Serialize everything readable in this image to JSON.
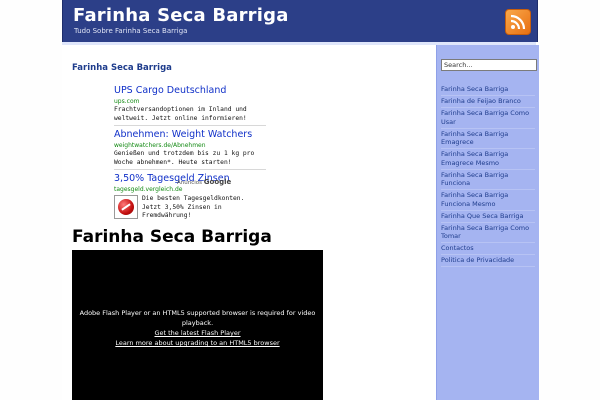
{
  "header": {
    "site_title": "Farinha Seca Barriga",
    "site_description": "Tudo Sobre Farinha Seca Barriga",
    "bg_color": "#2c3f88",
    "rss_icon": "rss-feed-icon"
  },
  "content": {
    "title": "Farinha Seca Barriga",
    "post_title": "Farinha Seca Barriga"
  },
  "ads": {
    "items": [
      {
        "title": "UPS Cargo Deutschland",
        "url": "ups.com",
        "text_line1": "Frachtversandoptionen im Inland und",
        "text_line2": "weltweit. Jetzt online informieren!"
      },
      {
        "title": "Abnehmen: Weight Watchers",
        "url": "weightwatchers.de/Abnehmen",
        "text_line1": "Genießen und trotzdem bis zu 1 kg pro",
        "text_line2": "Woche abnehmen*. Heute starten!"
      },
      {
        "title": "3,50% Tagesgeld Zinsen",
        "url": "tagesgeld.vergleich.de",
        "text_line1": "Die besten Tagesgeldkonten.",
        "text_line2": "Jetzt 3,50% Zinsen in",
        "text_line3": "Fremdwährung!"
      }
    ],
    "footer_label": "Anúncios",
    "footer_brand": "Google"
  },
  "player": {
    "message_line1": "Adobe Flash Player or an HTML5 supported browser is required for video",
    "message_line2": "playback.",
    "link1": "Get the latest Flash Player",
    "link2": "Learn more about upgrading to an HTML5 browser"
  },
  "sidebar": {
    "search_value": "Search...",
    "bg_color": "#a5b4f1",
    "items": [
      {
        "label": "Farinha Seca Barriga"
      },
      {
        "label": "Farinha de Feijao Branco"
      },
      {
        "label": "Farinha Seca Barriga Como Usar"
      },
      {
        "label": "Farinha Seca Barriga Emagrece"
      },
      {
        "label": "Farinha Seca Barriga Emagrece Mesmo"
      },
      {
        "label": "Farinha Seca Barriga Funciona"
      },
      {
        "label": "Farinha Seca Barriga Funciona Mesmo"
      },
      {
        "label": "Farinha Que Seca Barriga"
      },
      {
        "label": "Farinha Seca Barriga Como Tomar"
      },
      {
        "label": "Contactos"
      },
      {
        "label": "Politica de Privacidade"
      }
    ]
  }
}
